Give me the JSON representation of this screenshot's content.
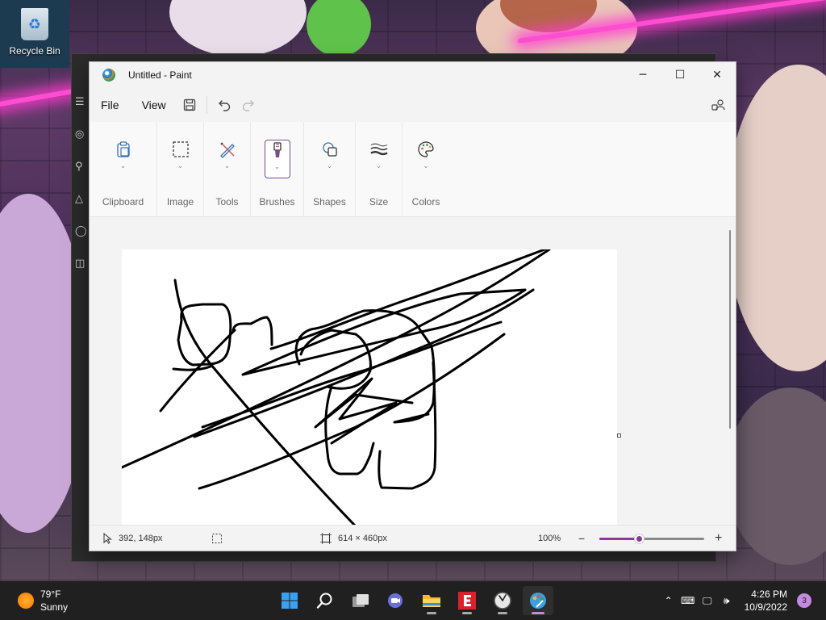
{
  "desktop": {
    "recycle_bin_label": "Recycle Bin"
  },
  "window": {
    "title": "Untitled - Paint",
    "minimize": "─",
    "maximize": "☐",
    "close": "✕"
  },
  "menu": {
    "file": "File",
    "view": "View"
  },
  "ribbon": {
    "groups": [
      {
        "label": "Clipboard",
        "icon": "clipboard-icon"
      },
      {
        "label": "Image",
        "icon": "selection-icon"
      },
      {
        "label": "Tools",
        "icon": "pencil-icon"
      },
      {
        "label": "Brushes",
        "icon": "brush-icon",
        "active": true
      },
      {
        "label": "Shapes",
        "icon": "shapes-icon"
      },
      {
        "label": "Size",
        "icon": "line-size-icon"
      },
      {
        "label": "Colors",
        "icon": "palette-icon"
      }
    ]
  },
  "status": {
    "cursor_position": "392, 148px",
    "canvas_size": "614 × 460px",
    "zoom": "100%",
    "zoom_out": "−",
    "zoom_in": "+",
    "zoom_slider_fraction": 0.38
  },
  "taskbar": {
    "weather_temp": "79°F",
    "weather_desc": "Sunny",
    "time": "4:26 PM",
    "date": "10/9/2022",
    "notification_count": "3",
    "apps": [
      "start-icon",
      "search-icon",
      "task-view-icon",
      "chat-icon",
      "file-explorer-icon",
      "app-e-icon",
      "clock-app-icon",
      "paint-icon"
    ]
  },
  "colors": {
    "accent": "#8a3a9a",
    "taskbar": "#202020"
  }
}
